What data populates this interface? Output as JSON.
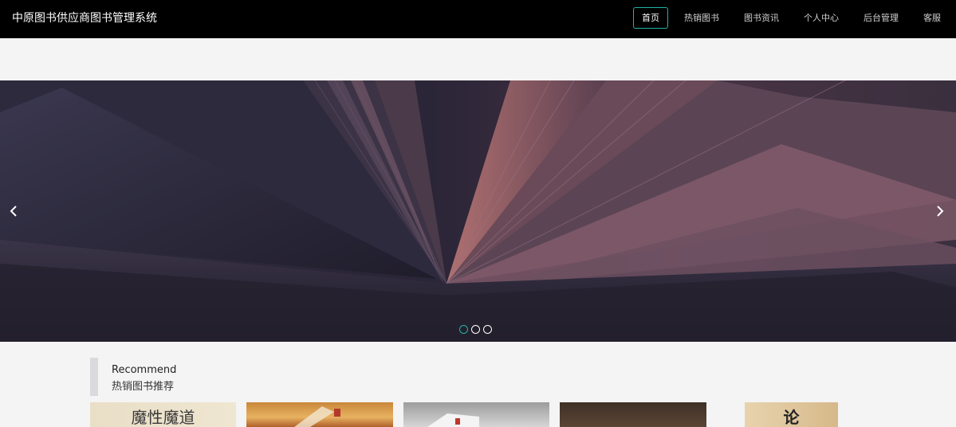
{
  "header": {
    "site_title": "中原图书供应商图书管理系统",
    "nav": [
      {
        "label": "首页",
        "active": true
      },
      {
        "label": "热销图书",
        "active": false
      },
      {
        "label": "图书资讯",
        "active": false
      },
      {
        "label": "个人中心",
        "active": false
      },
      {
        "label": "后台管理",
        "active": false
      },
      {
        "label": "客服",
        "active": false
      }
    ]
  },
  "carousel": {
    "slide_count": 3,
    "active_index": 0,
    "prev_icon": "chevron-left-icon",
    "next_icon": "chevron-right-icon"
  },
  "recommend": {
    "title_en": "Recommend",
    "title_cn": "热销图书推荐",
    "books": [
      {
        "cover_text": "魔性魔道"
      },
      {
        "cover_text": ""
      },
      {
        "cover_text": ""
      },
      {
        "cover_text": ""
      },
      {
        "cover_text": "论"
      }
    ]
  },
  "colors": {
    "header_bg": "#000000",
    "accent": "#22b3a5",
    "page_bg": "#f4f4f4"
  }
}
